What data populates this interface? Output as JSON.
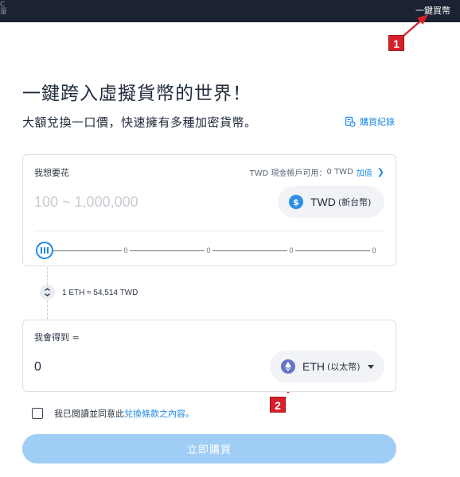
{
  "topbar": {
    "left_fragment": "C\n量",
    "link": "一鍵買幣"
  },
  "annotations": {
    "badge1": "1",
    "badge2": "2"
  },
  "headline": "一鍵跨入虛擬貨幣的世界！",
  "subline": "大額兌換一口價，快速擁有多種加密貨幣。",
  "history_link": "購買紀錄",
  "spend": {
    "label": "我想要花",
    "available_label": "TWD 現金帳戶可用：",
    "available_value": "0 TWD",
    "topup_link": "加值",
    "placeholder": "100 ~ 1,000,000",
    "currency_code": "TWD",
    "currency_name": "(新台幣)",
    "slider_ticks": [
      "0",
      "0",
      "0",
      "0"
    ],
    "slider_value": 0
  },
  "rate_text": "1 ETH ≈ 54,514 TWD",
  "receive": {
    "label": "我會得到 ≈",
    "value": "0",
    "currency_code": "ETH",
    "currency_name": "(以太幣)"
  },
  "agreement": {
    "prefix": "我已閱讀並同意此",
    "link": "兌換條款之內容",
    "suffix": "。"
  },
  "buy_button": "立即購買",
  "colors": {
    "accent": "#1e88e5",
    "topbar": "#1a2233",
    "button_disabled": "#9fcdf5",
    "annotation_red": "#d8202a"
  },
  "icons": {
    "twd": "dollar-coin-icon",
    "eth": "ethereum-icon",
    "history": "receipt-icon",
    "swap": "swap-vertical-icon"
  }
}
